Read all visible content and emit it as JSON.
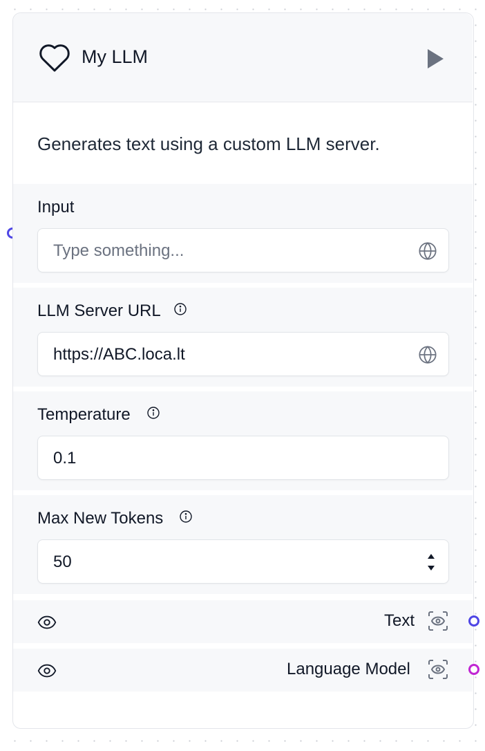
{
  "node": {
    "title": "My LLM",
    "description": "Generates text using a custom LLM server."
  },
  "inputs": {
    "input": {
      "label": "Input",
      "placeholder": "Type something...",
      "value": ""
    },
    "server_url": {
      "label": "LLM Server URL",
      "value": "https://ABC.loca.lt"
    },
    "temperature": {
      "label": "Temperature",
      "value": "0.1"
    },
    "max_new_tokens": {
      "label": "Max New Tokens",
      "value": "50"
    }
  },
  "outputs": [
    {
      "label": "Text",
      "handle_color": "#4f46e5"
    },
    {
      "label": "Language Model",
      "handle_color": "#c026d3"
    }
  ],
  "icons": {
    "header": "heart-icon",
    "run": "play-icon",
    "field_adornment": "globe-icon",
    "info": "info-icon",
    "visibility": "eye-icon",
    "inspect": "scan-eye-icon"
  },
  "colors": {
    "input_handle": "#4f46e5",
    "icon_gray": "#6b7280",
    "section_bg": "#f7f8fa"
  }
}
